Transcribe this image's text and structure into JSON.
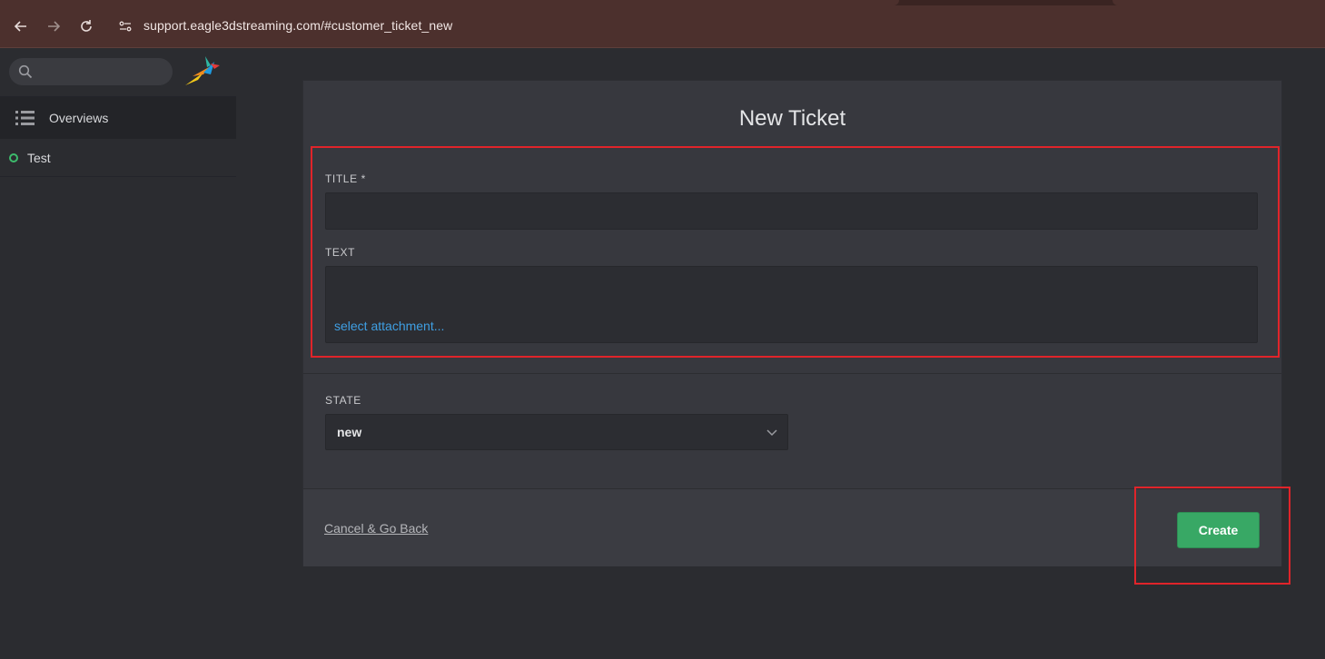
{
  "browser": {
    "url": "support.eagle3dstreaming.com/#customer_ticket_new"
  },
  "sidebar": {
    "search_placeholder": "",
    "overviews_label": "Overviews",
    "items": [
      {
        "label": "Test",
        "status_color": "#3dbb6c"
      }
    ]
  },
  "form": {
    "heading": "New Ticket",
    "title_label": "TITLE *",
    "title_value": "",
    "text_label": "TEXT",
    "text_value": "",
    "attachment_link": "select attachment...",
    "state_label": "STATE",
    "state_value": "new",
    "cancel_label": "Cancel & Go Back",
    "create_label": "Create"
  },
  "colors": {
    "accent_green": "#38a865",
    "link_blue": "#3f9fe3",
    "annotation_red": "#e0242a"
  }
}
